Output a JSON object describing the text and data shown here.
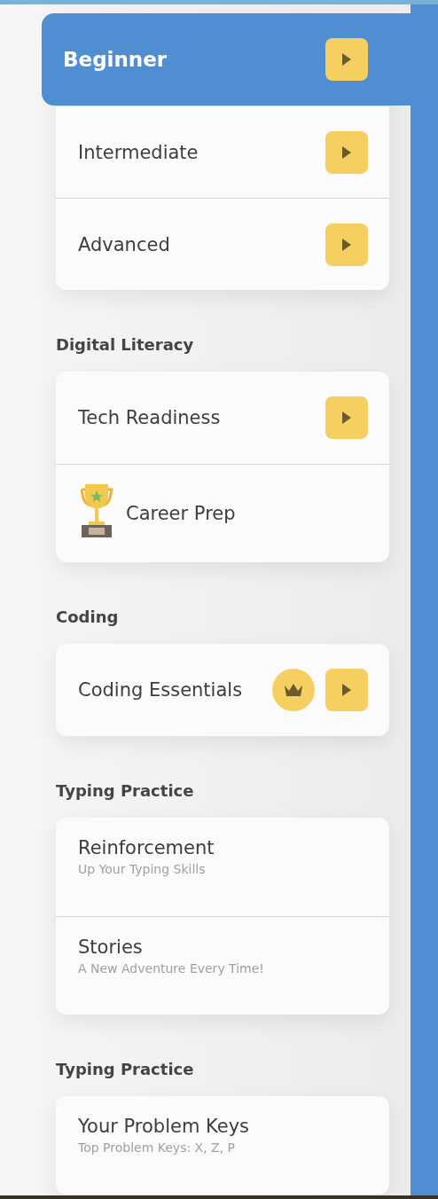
{
  "sections": [
    {
      "items": [
        {
          "label": "Beginner",
          "selected": true,
          "kind": "play"
        },
        {
          "label": "Intermediate",
          "selected": false,
          "kind": "play"
        },
        {
          "label": "Advanced",
          "selected": false,
          "kind": "play"
        }
      ]
    },
    {
      "heading": "Digital Literacy",
      "items": [
        {
          "label": "Tech Readiness",
          "selected": false,
          "kind": "play"
        },
        {
          "label": "Career Prep",
          "selected": false,
          "kind": "trophy"
        }
      ]
    },
    {
      "heading": "Coding",
      "items": [
        {
          "label": "Coding Essentials",
          "selected": false,
          "kind": "premium"
        }
      ]
    },
    {
      "heading": "Typing Practice",
      "items": [
        {
          "label": "Reinforcement",
          "subtitle": "Up Your Typing Skills",
          "selected": false,
          "kind": "text"
        },
        {
          "label": "Stories",
          "subtitle": "A New Adventure Every Time!",
          "selected": false,
          "kind": "text"
        }
      ]
    },
    {
      "heading": "Typing Practice",
      "items": [
        {
          "label": "Your Problem Keys",
          "subtitle": "Top Problem Keys: X, Z, P",
          "selected": false,
          "kind": "text"
        }
      ]
    }
  ]
}
